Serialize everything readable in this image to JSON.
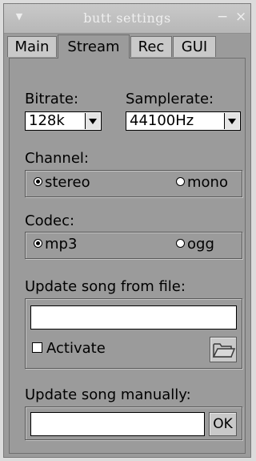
{
  "window": {
    "title": "butt settings",
    "menu_glyph": "▼",
    "minimize_glyph": "−",
    "close_glyph": "×"
  },
  "tabs": [
    {
      "label": "Main",
      "active": false
    },
    {
      "label": "Stream",
      "active": true
    },
    {
      "label": "Rec",
      "active": false
    },
    {
      "label": "GUI",
      "active": false
    }
  ],
  "stream": {
    "bitrate": {
      "label": "Bitrate:",
      "value": "128k"
    },
    "samplerate": {
      "label": "Samplerate:",
      "value": "44100Hz"
    },
    "channel": {
      "label": "Channel:",
      "options": [
        {
          "label": "stereo",
          "selected": true
        },
        {
          "label": "mono",
          "selected": false
        }
      ]
    },
    "codec": {
      "label": "Codec:",
      "options": [
        {
          "label": "mp3",
          "selected": true
        },
        {
          "label": "ogg",
          "selected": false
        }
      ]
    },
    "update_from_file": {
      "label": "Update song from file:",
      "path_value": "",
      "activate_label": "Activate",
      "activate_checked": false,
      "browse_icon": "folder-icon"
    },
    "update_manually": {
      "label": "Update song manually:",
      "song_value": "",
      "ok_label": "OK"
    }
  }
}
